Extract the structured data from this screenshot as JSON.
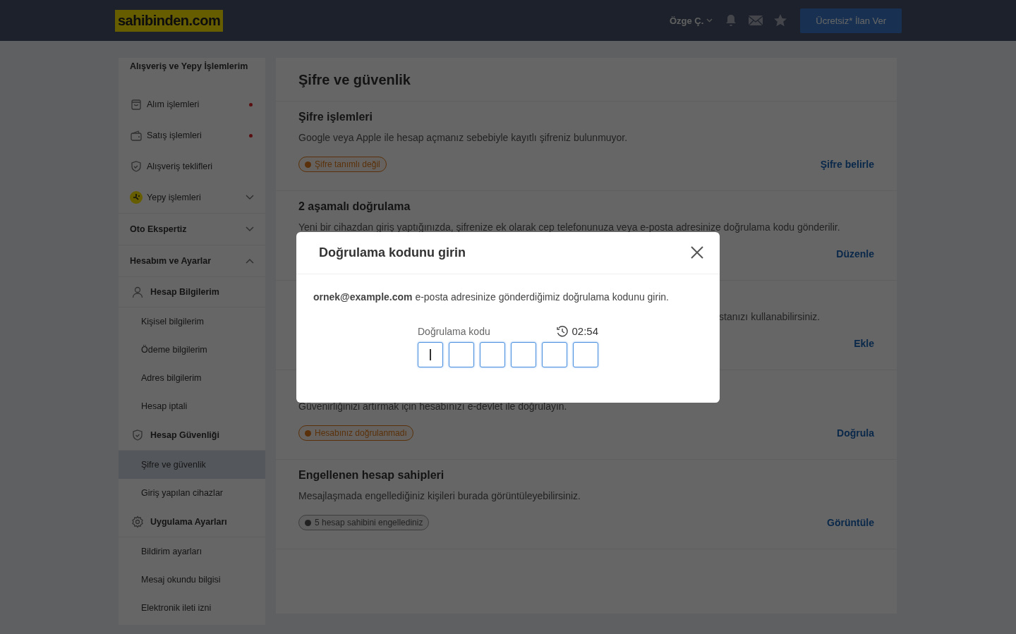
{
  "topbar": {
    "logo": "sahibinden.com",
    "user": "Özge Ç.",
    "post_button": "Ücretsiz* İlan Ver"
  },
  "sidebar": {
    "items": [
      {
        "kind": "header",
        "label": "Alışveriş ve Yepy İşlemlerim"
      },
      {
        "kind": "item",
        "label": "Alım işlemleri",
        "dot": true
      },
      {
        "kind": "item",
        "label": "Satış işlemleri",
        "dot": true
      },
      {
        "kind": "item",
        "label": "Alışveriş teklifleri",
        "dot": false
      },
      {
        "kind": "collapsible",
        "label": "Yepy işlemleri",
        "expanded": false
      },
      {
        "kind": "group",
        "label": "Oto Ekspertiz",
        "expanded": false
      },
      {
        "kind": "group",
        "label": "Hesabım ve Ayarlar",
        "expanded": true
      },
      {
        "kind": "subheader",
        "label": "Hesap Bilgilerim"
      },
      {
        "kind": "subitem",
        "label": "Kişisel bilgilerim",
        "selected": false
      },
      {
        "kind": "subitem",
        "label": "Ödeme bilgilerim",
        "selected": false
      },
      {
        "kind": "subitem",
        "label": "Adres bilgilerim",
        "selected": false
      },
      {
        "kind": "subitem",
        "label": "Hesap iptali",
        "selected": false
      },
      {
        "kind": "subheader",
        "label": "Hesap Güvenliği"
      },
      {
        "kind": "subitem",
        "label": "Şifre ve güvenlik",
        "selected": true
      },
      {
        "kind": "subitem",
        "label": "Giriş yapılan cihazlar",
        "selected": false
      },
      {
        "kind": "subheader",
        "label": "Uygulama Ayarları"
      },
      {
        "kind": "subitem",
        "label": "Bildirim ayarları",
        "selected": false
      },
      {
        "kind": "subitem",
        "label": "Mesaj okundu bilgisi",
        "selected": false
      },
      {
        "kind": "subitem",
        "label": "Elektronik ileti izni",
        "selected": false
      }
    ]
  },
  "main": {
    "title": "Şifre ve güvenlik",
    "sections": [
      {
        "title": "Şifre işlemleri",
        "description": "Google veya Apple ile hesap açmanız sebebiyle kayıtlı şifreniz bulunmuyor.",
        "badge": {
          "kind": "warning",
          "text": "Şifre tanımlı değil"
        },
        "action": "Şifre belirle"
      },
      {
        "title": "2 aşamalı doğrulama",
        "description": "Yeni bir cihazdan giriş yaptığınızda, şifrenize ek olarak cep telefonunuza veya e-posta adresinize doğrulama kodu gönderilir.",
        "action": "Düzenle"
      },
      {
        "description_end": "stanızı kullanabilirsiniz.",
        "action": "Ekle"
      },
      {
        "description": "Güvenirliğinizi artırmak için hesabınızı e-devlet ile doğrulayın.",
        "badge": {
          "kind": "warning",
          "text": "Hesabınız doğrulanmadı"
        },
        "action": "Doğrula"
      },
      {
        "title": "Engellenen hesap sahipleri",
        "description": "Mesajlaşmada engellediğiniz kişileri burada görüntüleyebilirsiniz.",
        "badge": {
          "kind": "info",
          "text": "5 hesap sahibini engellediniz"
        },
        "action": "Görüntüle"
      }
    ]
  },
  "modal": {
    "title": "Doğrulama kodunu girin",
    "message": "**ornek@example.com** e-posta adresinize gönderdiğimiz doğrulama kodunu girin.",
    "field_label": "Doğrulama kodu",
    "timer": "02:54",
    "code_boxes": [
      {
        "focused": true
      },
      {
        "focused": false
      },
      {
        "focused": false
      },
      {
        "focused": false
      },
      {
        "focused": false
      },
      {
        "focused": false
      }
    ]
  }
}
